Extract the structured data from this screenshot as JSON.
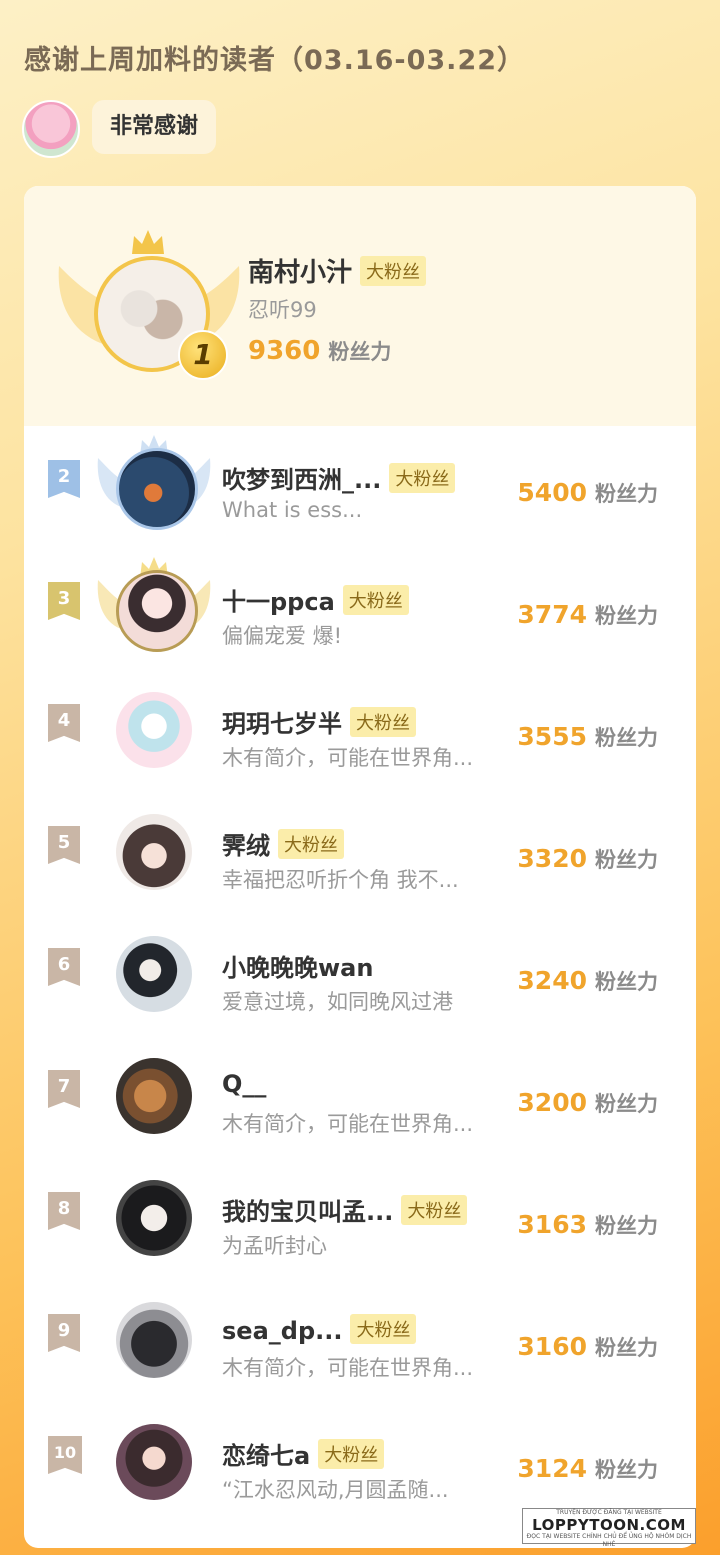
{
  "header": {
    "title": "感谢上周加料的读者（03.16-03.22）",
    "thanks_label": "非常感谢"
  },
  "top_fan": {
    "rank": "1",
    "name": "南村小汁",
    "badge": "大粉丝",
    "bio": "忍听99",
    "score": "9360",
    "unit": "粉丝力"
  },
  "fans": [
    {
      "rank": "2",
      "name": "吹梦到西洲_...",
      "badge": "大粉丝",
      "bio": "What is ess...",
      "score": "5400",
      "unit": "粉丝力"
    },
    {
      "rank": "3",
      "name": "十一ppca",
      "badge": "大粉丝",
      "bio": "偏偏宠爱 爆!",
      "score": "3774",
      "unit": "粉丝力"
    },
    {
      "rank": "4",
      "name": "玥玥七岁半",
      "badge": "大粉丝",
      "bio": "木有简介，可能在世界角...",
      "score": "3555",
      "unit": "粉丝力"
    },
    {
      "rank": "5",
      "name": "霁绒",
      "badge": "大粉丝",
      "bio": "幸福把忍听折个角 我不...",
      "score": "3320",
      "unit": "粉丝力"
    },
    {
      "rank": "6",
      "name": "小晚晚晚wan",
      "badge": "",
      "bio": "爱意过境，如同晚风过港",
      "score": "3240",
      "unit": "粉丝力"
    },
    {
      "rank": "7",
      "name": "Q__",
      "badge": "",
      "bio": "木有简介，可能在世界角...",
      "score": "3200",
      "unit": "粉丝力"
    },
    {
      "rank": "8",
      "name": "我的宝贝叫孟...",
      "badge": "大粉丝",
      "bio": "为孟听封心",
      "score": "3163",
      "unit": "粉丝力"
    },
    {
      "rank": "9",
      "name": "sea_dp...",
      "badge": "大粉丝",
      "bio": "木有简介，可能在世界角...",
      "score": "3160",
      "unit": "粉丝力"
    },
    {
      "rank": "10",
      "name": "恋绮七a",
      "badge": "大粉丝",
      "bio": "“江水忍风动,月圆孟随...",
      "score": "3124",
      "unit": "粉丝力"
    }
  ],
  "watermark": {
    "top": "TRUYỆN ĐƯỢC ĐĂNG TẠI WEBSITE",
    "main": "LOPPYTOON.COM",
    "bottom": "ĐỌC TẠI WEBSITE CHÍNH CHỦ ĐỂ ỦNG HỘ NHÓM DỊCH NHÉ"
  },
  "colors": {
    "accent": "#f0a42c",
    "badge_bg": "#fbedaa",
    "rank2": "#9ec0e6",
    "rank3": "#d8c46e",
    "rank_other": "#c9b6a6"
  }
}
